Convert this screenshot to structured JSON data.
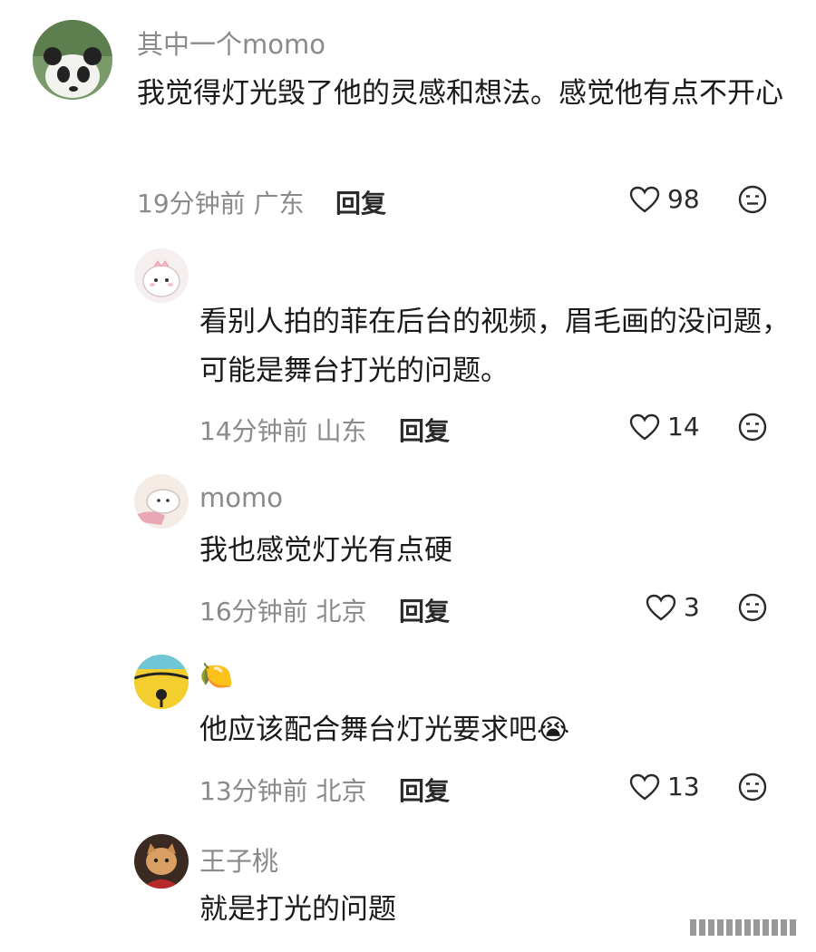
{
  "comments": [
    {
      "name": "其中一个momo",
      "text": "我觉得灯光毁了他的灵感和想法。感觉他有点不开心",
      "time": "19分钟前",
      "location": "广东",
      "reply_label": "回复",
      "likes": "98",
      "avatar_icon": "panda-avatar-icon"
    },
    {
      "name": "",
      "text": "看别人拍的菲在后台的视频，眉毛画的没问题，可能是舞台打光的问题。",
      "time": "14分钟前",
      "location": "山东",
      "reply_label": "回复",
      "likes": "14",
      "avatar_icon": "cartoon-dinosaur-avatar-icon"
    },
    {
      "name": "momo",
      "text": "我也感觉灯光有点硬",
      "time": "16分钟前",
      "location": "北京",
      "reply_label": "回复",
      "likes": "3",
      "avatar_icon": "cartoon-creature-avatar-icon"
    },
    {
      "name": "🍋",
      "text": "他应该配合舞台灯光要求吧",
      "text_emoji": "😭",
      "time": "13分钟前",
      "location": "北京",
      "reply_label": "回复",
      "likes": "13",
      "avatar_icon": "yellow-bell-avatar-icon"
    },
    {
      "name": "王子桃",
      "text": "就是打光的问题",
      "avatar_icon": "cat-avatar-icon"
    }
  ],
  "colors": {
    "meta_gray": "#8a8a8a",
    "text_dark": "#1a1a1a"
  }
}
